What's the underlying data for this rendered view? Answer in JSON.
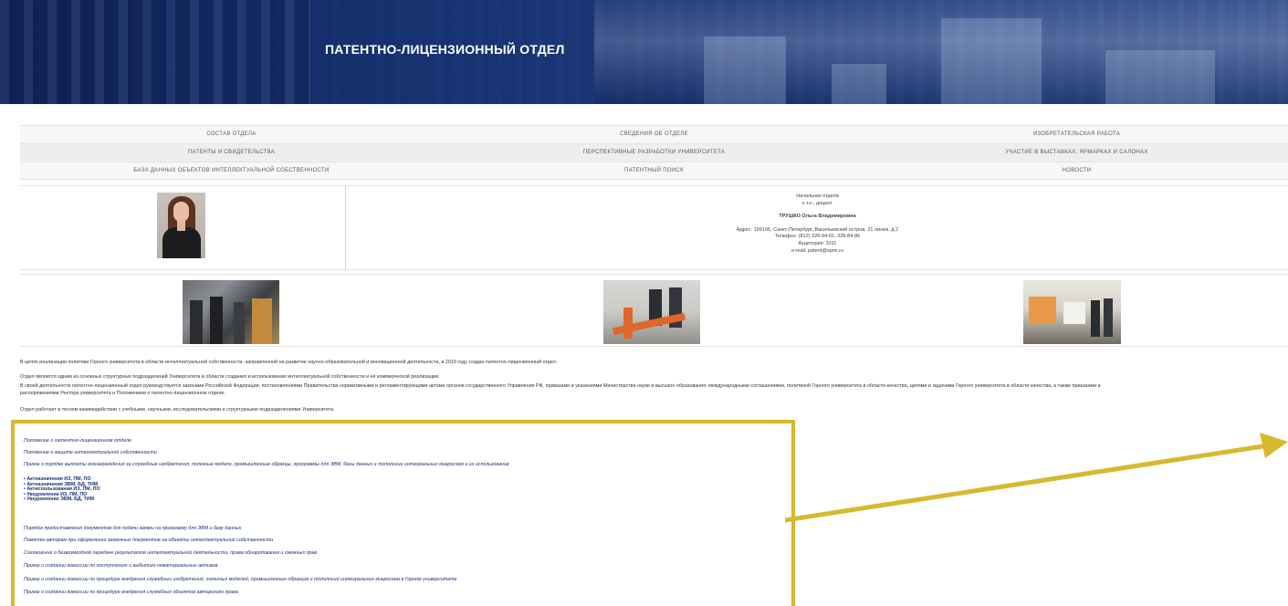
{
  "header": {
    "title": "ПАТЕНТНО-ЛИЦЕНЗИОННЫЙ ОТДЕЛ"
  },
  "nav": {
    "rows": [
      [
        "СОСТАВ ОТДЕЛА",
        "СВЕДЕНИЯ ОБ ОТДЕЛЕ",
        "ИЗОБРЕТАТЕЛЬСКАЯ РАБОТА"
      ],
      [
        "ПАТЕНТЫ И СВИДЕТЕЛЬСТВА",
        "ПЕРСПЕКТИВНЫЕ РАЗРАБОТКИ УНИВЕРСИТЕТА",
        "УЧАСТИЕ В ВЫСТАВКАХ, ЯРМАРКАХ И САЛОНАХ"
      ],
      [
        "БАЗА ДАННЫХ ОБЪЕКТОВ ИНТЕЛЛЕКТУАЛЬНОЙ СОБСТВЕННОСТИ",
        "ПАТЕНТНЫЙ ПОИСК",
        "НОВОСТИ"
      ]
    ]
  },
  "contact": {
    "position": "Начальник отдела",
    "degree": "к.т.н., доцент",
    "name": "ТРУШКО Ольга Владимировна",
    "address": "Адрес: 199106, Санкт-Петербург, Васильевский остров, 21 линия, д.2",
    "phone": "Телефон: (812) 328-84-01, 328-84-86",
    "room": "Аудитория: 3311",
    "email": "e-mail: patent@spmi.ru"
  },
  "paragraphs": [
    "В целях реализации политики Горного университета в области интеллектуальной собственности, направленной на развитие научно-образовательной и инновационной деятельности, в 2019 году создан патентно-лицензионный отдел.",
    "Отдел является одним из основных структурных подразделений Университета в области создания и использования интеллектуальной собственности и её коммерческой реализации.",
    "В своей деятельности патентно-лицензионный отдел руководствуется законами Российской Федерации, постановлениями Правительства нормативными и регламентирующими актами органов государственного Управления РФ, приказами и указаниями Министерства науки и высшего образования, международными соглашениями, политикой Горного университета в области качества, целями и задачами Горного университета в области качества, а также приказами и",
    "распоряжениями Ректора университета и Положением о патентно-лицензионном отделе.",
    "Отдел работает в тесном взаимодействии с учебными, научными, исследовательскими и структурными подразделениями Университета."
  ],
  "documents": {
    "links_top": [
      "Положение о патентно-лицензионном отделе",
      "Положение о защите интеллектуальной собственности",
      "Приказ о порядке выплаты вознаграждения за служебные изобретения, полезные модели, промышленные образцы, программы для ЭВМ, базы данных и топологии интегральных микросхем и их использование"
    ],
    "list_items": [
      "Актназначения ИЗ, ПМ, ПО",
      "Актназначения ЭВМ, БД, ТИМ",
      "Актиспользования ИЗ, ПМ, ПО",
      "Уведомление ИЗ, ПМ, ПО",
      "Уведомление ЭВМ, БД, ТИМ"
    ],
    "links_bottom": [
      "Порядок предоставления документов для подачи заявки на программу для ЭВМ и базу данных",
      "Памятка авторам при оформлении заявочных документов на объекты интеллектуальной собственности",
      "Соглашение о безвозмездной передаче результатов интеллектуальной деятельности, права обнародования и смежных прав",
      "Приказ о создании комиссии по поступлению и выбытию нематериальных активов",
      "Приказ о создании комиссии по процедуре внедрения служебных изобретений, полезных моделей, промышленных образцов и топологий интегральных микросхем в Горном университете",
      "Приказ о создании комиссии по процедуре внедрения служебных объектов авторского права"
    ]
  },
  "colors": {
    "banner": "#1d3673",
    "highlight": "#d6b92c",
    "link": "#1a2f7a"
  }
}
